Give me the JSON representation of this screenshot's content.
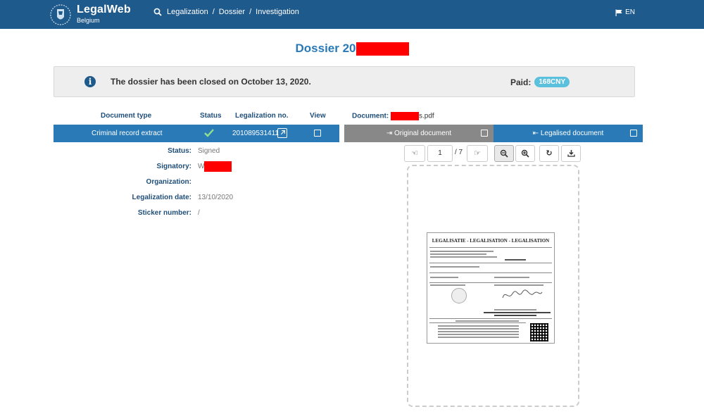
{
  "header": {
    "brand_name": "LegalWeb",
    "brand_sub": "Belgium",
    "breadcrumb": [
      "Legalization",
      "Dossier",
      "Investigation"
    ],
    "language": "EN"
  },
  "page_title_prefix": "Dossier 20",
  "alert": {
    "text": "The dossier has been closed on October 13, 2020.",
    "paid_label": "Paid:",
    "paid_value": "168CNY"
  },
  "table": {
    "headers": {
      "type": "Document type",
      "status": "Status",
      "legno": "Legalization no.",
      "view": "View"
    },
    "row": {
      "type": "Criminal record extract",
      "legno": "201089531411"
    }
  },
  "details": {
    "status_label": "Status:",
    "status_value": "Signed",
    "signatory_label": "Signatory:",
    "signatory_value": "W",
    "organization_label": "Organization:",
    "organization_value": "",
    "date_label": "Legalization date:",
    "date_value": "13/10/2020",
    "sticker_label": "Sticker number:",
    "sticker_value": "/"
  },
  "document": {
    "label": "Document:",
    "filename_suffix": "s.pdf",
    "tab_original": "Original document",
    "tab_legalised": "Legalised document",
    "page_current": "1",
    "page_total": "/ 7",
    "paper_title": "LEGALISATIE - LEGALISATION - LEGALISATION"
  },
  "colors": {
    "header": "#1f5a8c",
    "accent": "#2a7ab8",
    "badge": "#5bc0de",
    "redaction": "#ff0000"
  }
}
